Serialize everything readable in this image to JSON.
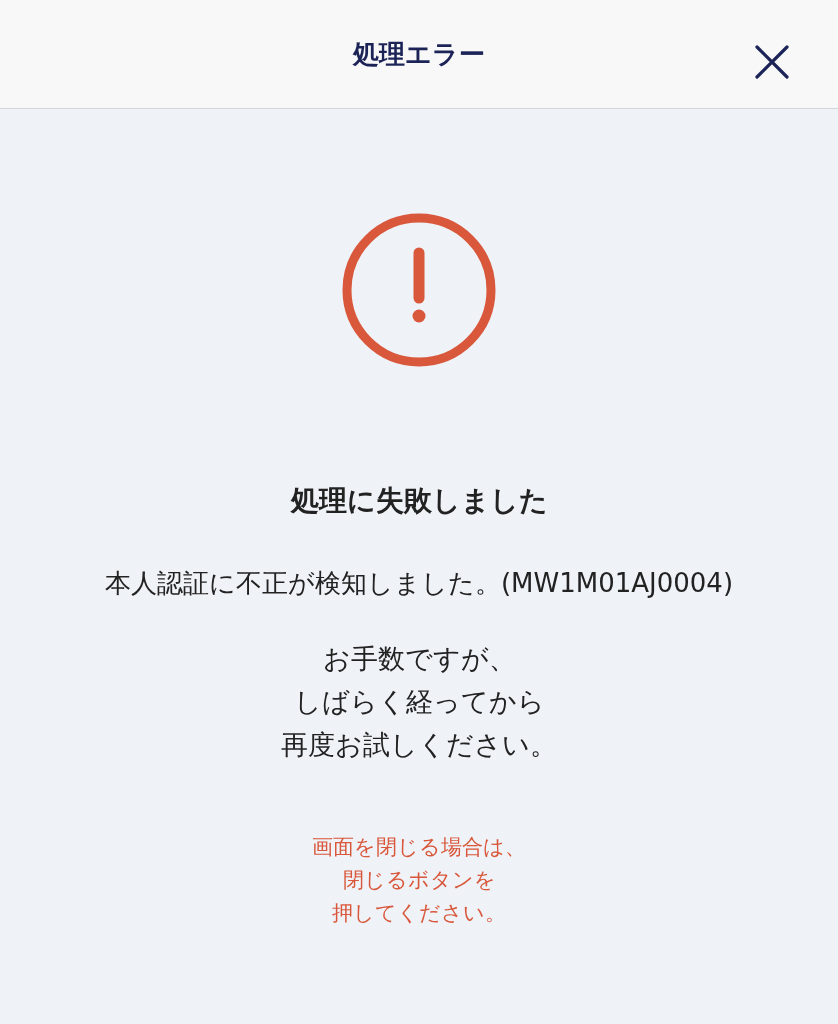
{
  "header": {
    "title": "処理エラー"
  },
  "error": {
    "heading": "処理に失敗しました",
    "message": "本人認証に不正が検知しました。(MW1M01AJ0004)",
    "advice": [
      "お手数ですが、",
      "しばらく経ってから",
      "再度お試しください。"
    ],
    "note": [
      "画面を閉じる場合は、",
      "閉じるボタンを",
      "押してください。"
    ]
  }
}
